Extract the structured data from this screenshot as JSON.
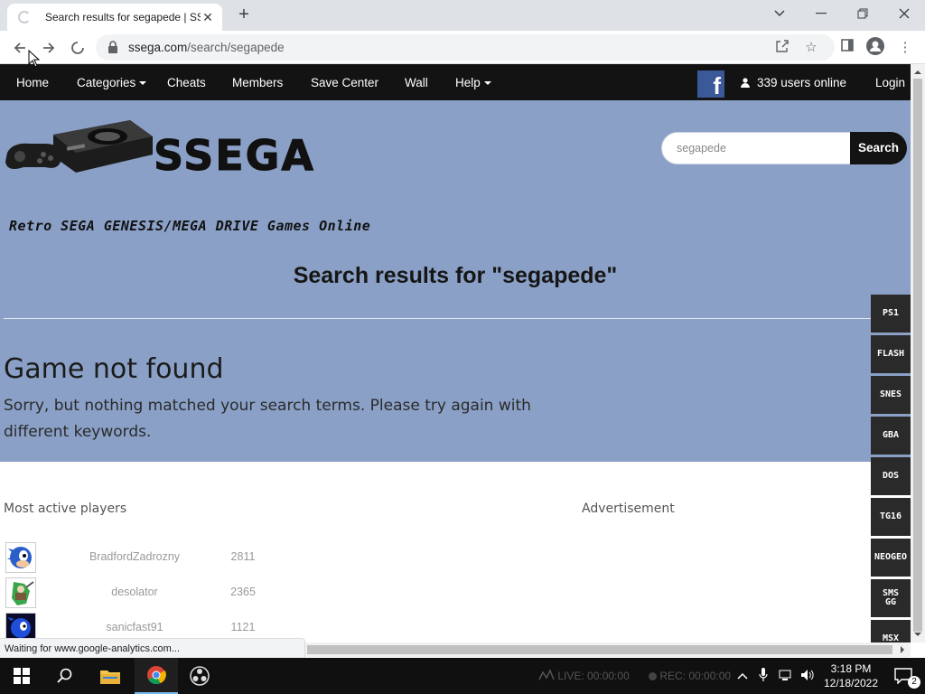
{
  "browser": {
    "tab_title": "Search results for segapede | SSega",
    "url_host": "ssega.com",
    "url_path": "/search/segapede",
    "status_text": "Waiting for www.google-analytics.com..."
  },
  "site": {
    "nav": {
      "home": "Home",
      "categories": "Categories",
      "cheats": "Cheats",
      "members": "Members",
      "save_center": "Save Center",
      "wall": "Wall",
      "help": "Help",
      "fb": "f",
      "users_online": "339 users online",
      "login": "Login"
    },
    "logo": {
      "name": "SSEGA",
      "tagline": "Retro SEGA GENESIS/MEGA DRIVE Games Online"
    },
    "search": {
      "value": "segapede",
      "button": "Search"
    },
    "results_title": "Search results for \"segapede\"",
    "not_found_title": "Game not found",
    "not_found_text": "Sorry, but nothing matched your search terms. Please try again with different keywords.",
    "most_active_heading": "Most active players",
    "advertisement_heading": "Advertisement",
    "players": [
      {
        "name": "BradfordZadrozny",
        "score": "2811"
      },
      {
        "name": "desolator",
        "score": "2365"
      },
      {
        "name": "sanicfast91",
        "score": "1121"
      }
    ],
    "side_systems": [
      "PS1",
      "FLASH",
      "SNES",
      "GBA",
      "DOS",
      "TG16",
      "NEOGEO",
      "SMS GG",
      "MSX"
    ]
  },
  "taskbar": {
    "live": "LIVE: 00:00:00",
    "rec": "REC: 00:00:00",
    "time": "3:18 PM",
    "date": "12/18/2022",
    "notifications": "2"
  },
  "colors": {
    "hero_bg": "#8aa0c6",
    "nav_bg": "#131313",
    "facebook": "#3b5998"
  }
}
